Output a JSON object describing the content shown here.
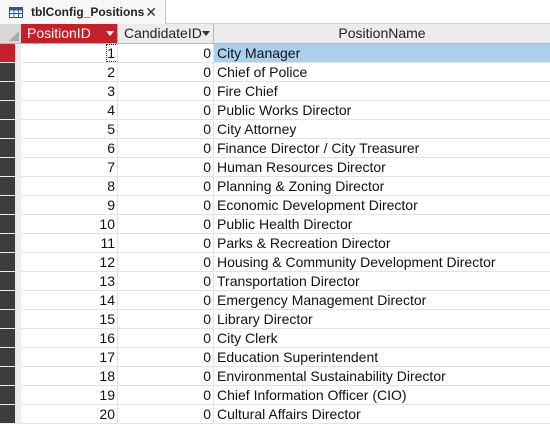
{
  "tab": {
    "title": "tblConfig_Positions",
    "close_glyph": "✕"
  },
  "columns": [
    {
      "label": "PositionID"
    },
    {
      "label": "CandidateID"
    },
    {
      "label": "PositionName"
    }
  ],
  "rows": [
    {
      "id": "1",
      "candidate": "0",
      "name": "City Manager"
    },
    {
      "id": "2",
      "candidate": "0",
      "name": "Chief of Police"
    },
    {
      "id": "3",
      "candidate": "0",
      "name": "Fire Chief"
    },
    {
      "id": "4",
      "candidate": "0",
      "name": "Public Works Director"
    },
    {
      "id": "5",
      "candidate": "0",
      "name": "City Attorney"
    },
    {
      "id": "6",
      "candidate": "0",
      "name": "Finance Director / City Treasurer"
    },
    {
      "id": "7",
      "candidate": "0",
      "name": "Human Resources Director"
    },
    {
      "id": "8",
      "candidate": "0",
      "name": "Planning & Zoning Director"
    },
    {
      "id": "9",
      "candidate": "0",
      "name": "Economic Development Director"
    },
    {
      "id": "10",
      "candidate": "0",
      "name": "Public Health Director"
    },
    {
      "id": "11",
      "candidate": "0",
      "name": "Parks & Recreation Director"
    },
    {
      "id": "12",
      "candidate": "0",
      "name": "Housing & Community Development Director"
    },
    {
      "id": "13",
      "candidate": "0",
      "name": "Transportation Director"
    },
    {
      "id": "14",
      "candidate": "0",
      "name": "Emergency Management Director"
    },
    {
      "id": "15",
      "candidate": "0",
      "name": "Library Director"
    },
    {
      "id": "16",
      "candidate": "0",
      "name": "City Clerk"
    },
    {
      "id": "17",
      "candidate": "0",
      "name": "Education Superintendent"
    },
    {
      "id": "18",
      "candidate": "0",
      "name": "Environmental Sustainability Director"
    },
    {
      "id": "19",
      "candidate": "0",
      "name": "Chief Information Officer (CIO)"
    },
    {
      "id": "20",
      "candidate": "0",
      "name": "Cultural Affairs Director"
    }
  ],
  "colors": {
    "accent_red": "#c5202a",
    "selection_blue": "#abd0ee",
    "record_selector": "#3c3c3c"
  },
  "icons": {
    "tab": "table-icon",
    "sort": "dropdown-arrow-icon"
  }
}
